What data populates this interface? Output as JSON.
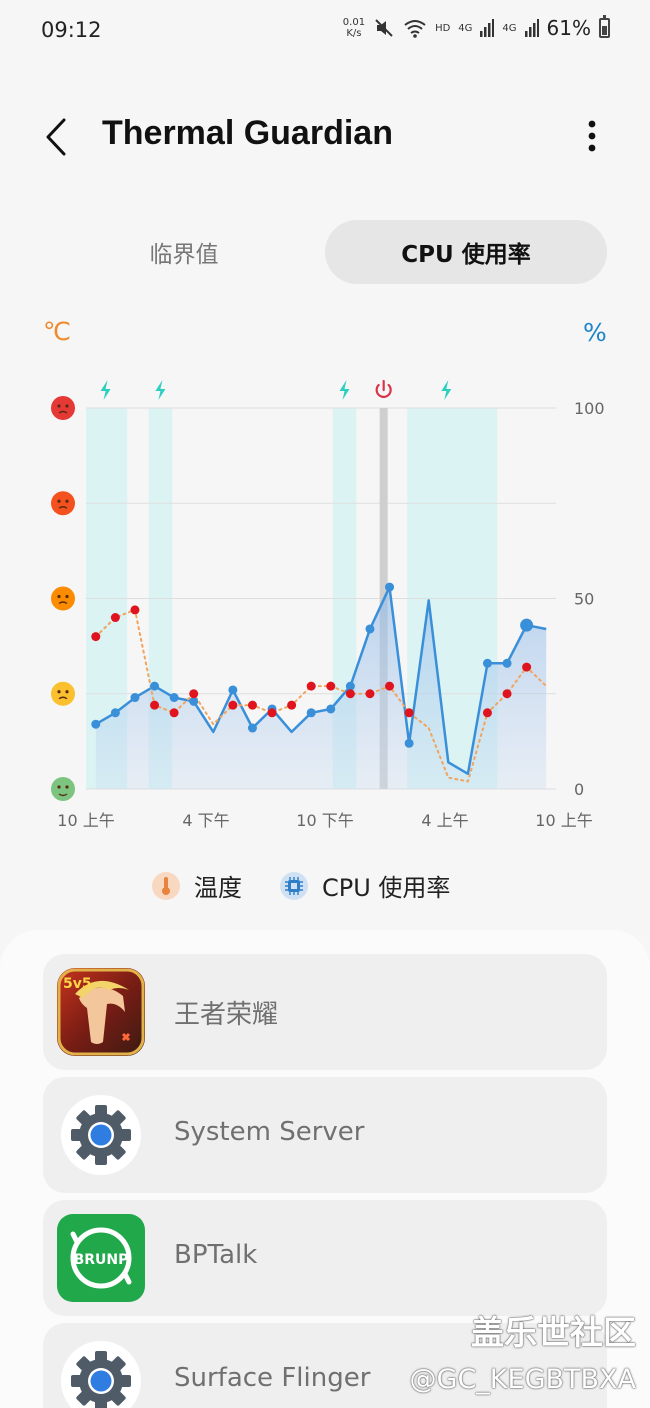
{
  "status_bar": {
    "time": "09:12",
    "net_speed_value": "0.01",
    "net_speed_unit": "K/s",
    "hd": "HD",
    "signal1": "4G",
    "signal2": "4G",
    "battery": "61%"
  },
  "header": {
    "title": "Thermal Guardian"
  },
  "tabs": [
    {
      "label": "临界值",
      "active": false
    },
    {
      "label": "CPU 使用率",
      "active": true
    }
  ],
  "chart_units": {
    "left": "℃",
    "right": "%"
  },
  "chart_data": {
    "type": "line",
    "x_ticks": [
      "10 上午",
      "4 下午",
      "10 下午",
      "4 上午",
      "10 上午"
    ],
    "y_right_ticks": [
      "100",
      "50",
      "0"
    ],
    "ylim": [
      0,
      100
    ],
    "charging_periods": [
      [
        0.0,
        2.1
      ],
      [
        3.2,
        4.4
      ],
      [
        12.6,
        13.8
      ],
      [
        16.4,
        21.0
      ]
    ],
    "event_markers": [
      {
        "x": 1.0,
        "type": "charging",
        "icon": "lightning-icon"
      },
      {
        "x": 3.8,
        "type": "charging",
        "icon": "lightning-icon"
      },
      {
        "x": 13.2,
        "type": "charging",
        "icon": "lightning-icon"
      },
      {
        "x": 15.2,
        "type": "power",
        "icon": "power-icon"
      },
      {
        "x": 18.4,
        "type": "charging",
        "icon": "lightning-icon"
      }
    ],
    "power_line_x": 15.2,
    "series": [
      {
        "name": "CPU 使用率",
        "color": "#3a8fd9",
        "points": [
          [
            0.5,
            17
          ],
          [
            1.5,
            20
          ],
          [
            2.5,
            24
          ],
          [
            3.5,
            27
          ],
          [
            4.5,
            24
          ],
          [
            5.5,
            23
          ],
          [
            6.5,
            15
          ],
          [
            7.5,
            26
          ],
          [
            8.5,
            16
          ],
          [
            9.5,
            21
          ],
          [
            10.5,
            15
          ],
          [
            11.5,
            20
          ],
          [
            12.5,
            21
          ],
          [
            13.5,
            27
          ],
          [
            14.5,
            42
          ],
          [
            15.5,
            53
          ],
          [
            16.5,
            12
          ],
          [
            17.5,
            49.5
          ],
          [
            18.5,
            7
          ],
          [
            19.5,
            4
          ],
          [
            20.5,
            33
          ],
          [
            21.5,
            33
          ],
          [
            22.5,
            43
          ],
          [
            23.5,
            42
          ]
        ]
      },
      {
        "name": "温度",
        "color": "#e05a2a",
        "points": [
          [
            0.5,
            40
          ],
          [
            1.5,
            45
          ],
          [
            2.5,
            47
          ],
          [
            3.5,
            22
          ],
          [
            4.5,
            20
          ],
          [
            5.5,
            25
          ],
          [
            6.5,
            17
          ],
          [
            7.5,
            22
          ],
          [
            8.5,
            22
          ],
          [
            9.5,
            20
          ],
          [
            10.5,
            22
          ],
          [
            11.5,
            27
          ],
          [
            12.5,
            27
          ],
          [
            13.5,
            25
          ],
          [
            14.5,
            25
          ],
          [
            15.5,
            27
          ],
          [
            16.5,
            20
          ],
          [
            17.5,
            16
          ],
          [
            18.5,
            3
          ],
          [
            19.5,
            2
          ],
          [
            20.5,
            20
          ],
          [
            21.5,
            25
          ],
          [
            22.5,
            32
          ],
          [
            23.5,
            27
          ]
        ]
      }
    ],
    "temp_levels": [
      {
        "level": 4,
        "color": "#e53935",
        "icon": "very-hot-face-icon"
      },
      {
        "level": 3,
        "color": "#f4511e",
        "icon": "hot-face-icon"
      },
      {
        "level": 2,
        "color": "#fb8c00",
        "icon": "warm-face-icon"
      },
      {
        "level": 1,
        "color": "#fbc02d",
        "icon": "neutral-face-icon"
      },
      {
        "level": 0,
        "color": "#7cc47f",
        "icon": "cool-face-icon"
      }
    ]
  },
  "legend": {
    "temp": "温度",
    "cpu": "CPU 使用率"
  },
  "apps": [
    {
      "name": "王者荣耀",
      "icon": "honor-of-kings-icon"
    },
    {
      "name": "System Server",
      "icon": "settings-gear-icon"
    },
    {
      "name": "BPTalk",
      "icon": "bptalk-icon",
      "icon_text": "BRUNP"
    },
    {
      "name": "Surface Flinger",
      "icon": "settings-gear-icon"
    }
  ],
  "watermark": {
    "line1": "盖乐世社区",
    "line2": "@GC_KEGBTBXA"
  }
}
